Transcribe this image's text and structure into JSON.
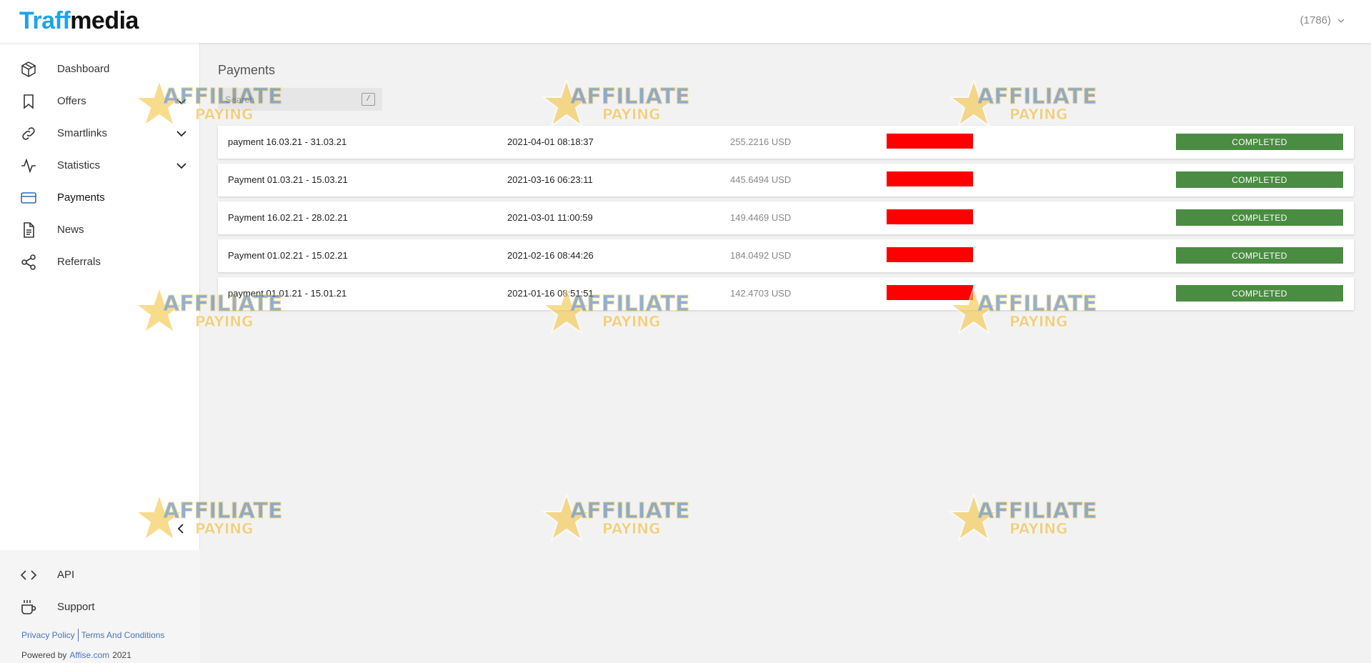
{
  "header": {
    "logo_part1": "Traff",
    "logo_part2": "media",
    "account_label": "(1786)"
  },
  "sidebar": {
    "items": [
      {
        "label": "Dashboard",
        "icon": "cube-icon"
      },
      {
        "label": "Offers",
        "icon": "bookmark-icon"
      },
      {
        "label": "Smartlinks",
        "icon": "link-icon"
      },
      {
        "label": "Statistics",
        "icon": "activity-icon"
      },
      {
        "label": "Payments",
        "icon": "credit-card-icon"
      },
      {
        "label": "News",
        "icon": "document-icon"
      },
      {
        "label": "Referrals",
        "icon": "share-icon"
      }
    ],
    "bottom_items": [
      {
        "label": "API",
        "icon": "code-icon"
      },
      {
        "label": "Support",
        "icon": "coffee-icon"
      }
    ],
    "privacy_label": "Privacy Policy",
    "terms_label": "Terms And Conditions",
    "powered_prefix": "Powered by",
    "powered_link": "Affise.com",
    "powered_year": "2021"
  },
  "main": {
    "title": "Payments",
    "search": {
      "placeholder": "Search",
      "shortcut": "/"
    },
    "payments": [
      {
        "name": "payment 16.03.21 - 31.03.21",
        "date": "2021-04-01 08:18:37",
        "amount": "255.2216 USD",
        "status": "COMPLETED"
      },
      {
        "name": "Payment 01.03.21 - 15.03.21",
        "date": "2021-03-16 06:23:11",
        "amount": "445.6494 USD",
        "status": "COMPLETED"
      },
      {
        "name": "Payment 16.02.21 - 28.02.21",
        "date": "2021-03-01 11:00:59",
        "amount": "149.4469 USD",
        "status": "COMPLETED"
      },
      {
        "name": "Payment 01.02.21 - 15.02.21",
        "date": "2021-02-16 08:44:26",
        "amount": "184.0492 USD",
        "status": "COMPLETED"
      },
      {
        "name": "payment 01.01.21 - 15.01.21",
        "date": "2021-01-16 08:51:51",
        "amount": "142.4703 USD",
        "status": "COMPLETED"
      }
    ]
  },
  "watermark": {
    "line1": "AFFILIATE",
    "line2": "PAYING"
  },
  "colors": {
    "brand_blue": "#1fa3e8",
    "status_completed": "#4a8c42",
    "redaction": "#ff0000",
    "link": "#4a73b8"
  }
}
